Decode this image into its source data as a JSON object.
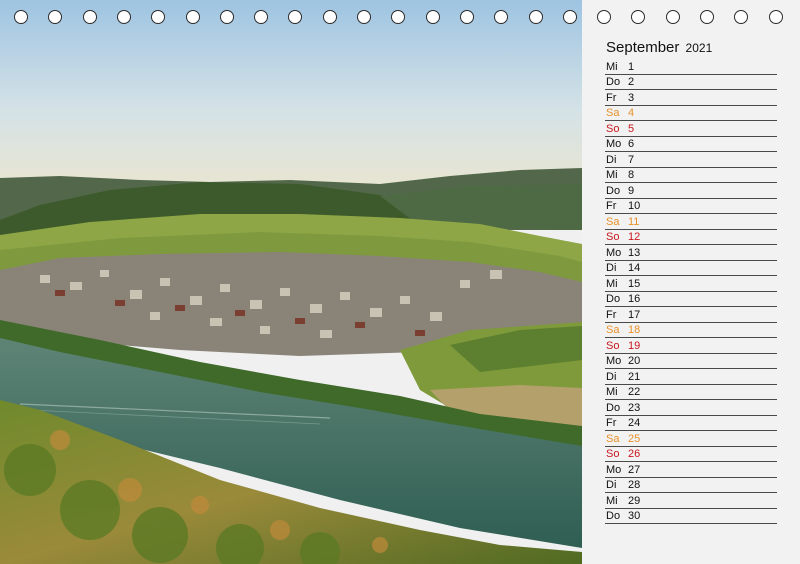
{
  "calendar": {
    "month": "September",
    "year": "2021",
    "days": [
      {
        "wd": "Mi",
        "d": "1",
        "type": "weekday"
      },
      {
        "wd": "Do",
        "d": "2",
        "type": "weekday"
      },
      {
        "wd": "Fr",
        "d": "3",
        "type": "weekday"
      },
      {
        "wd": "Sa",
        "d": "4",
        "type": "saturday"
      },
      {
        "wd": "So",
        "d": "5",
        "type": "sunday"
      },
      {
        "wd": "Mo",
        "d": "6",
        "type": "weekday"
      },
      {
        "wd": "Di",
        "d": "7",
        "type": "weekday"
      },
      {
        "wd": "Mi",
        "d": "8",
        "type": "weekday"
      },
      {
        "wd": "Do",
        "d": "9",
        "type": "weekday"
      },
      {
        "wd": "Fr",
        "d": "10",
        "type": "weekday"
      },
      {
        "wd": "Sa",
        "d": "11",
        "type": "saturday"
      },
      {
        "wd": "So",
        "d": "12",
        "type": "sunday"
      },
      {
        "wd": "Mo",
        "d": "13",
        "type": "weekday"
      },
      {
        "wd": "Di",
        "d": "14",
        "type": "weekday"
      },
      {
        "wd": "Mi",
        "d": "15",
        "type": "weekday"
      },
      {
        "wd": "Do",
        "d": "16",
        "type": "weekday"
      },
      {
        "wd": "Fr",
        "d": "17",
        "type": "weekday"
      },
      {
        "wd": "Sa",
        "d": "18",
        "type": "saturday"
      },
      {
        "wd": "So",
        "d": "19",
        "type": "sunday"
      },
      {
        "wd": "Mo",
        "d": "20",
        "type": "weekday"
      },
      {
        "wd": "Di",
        "d": "21",
        "type": "weekday"
      },
      {
        "wd": "Mi",
        "d": "22",
        "type": "weekday"
      },
      {
        "wd": "Do",
        "d": "23",
        "type": "weekday"
      },
      {
        "wd": "Fr",
        "d": "24",
        "type": "weekday"
      },
      {
        "wd": "Sa",
        "d": "25",
        "type": "saturday"
      },
      {
        "wd": "So",
        "d": "26",
        "type": "sunday"
      },
      {
        "wd": "Mo",
        "d": "27",
        "type": "weekday"
      },
      {
        "wd": "Di",
        "d": "28",
        "type": "weekday"
      },
      {
        "wd": "Mi",
        "d": "29",
        "type": "weekday"
      },
      {
        "wd": "Do",
        "d": "30",
        "type": "weekday"
      }
    ]
  },
  "colors": {
    "saturday": "#e8912a",
    "sunday": "#c8171f",
    "text": "#111111"
  },
  "binding_ring_count": 23,
  "photo_icon": "landscape-photo-icon"
}
